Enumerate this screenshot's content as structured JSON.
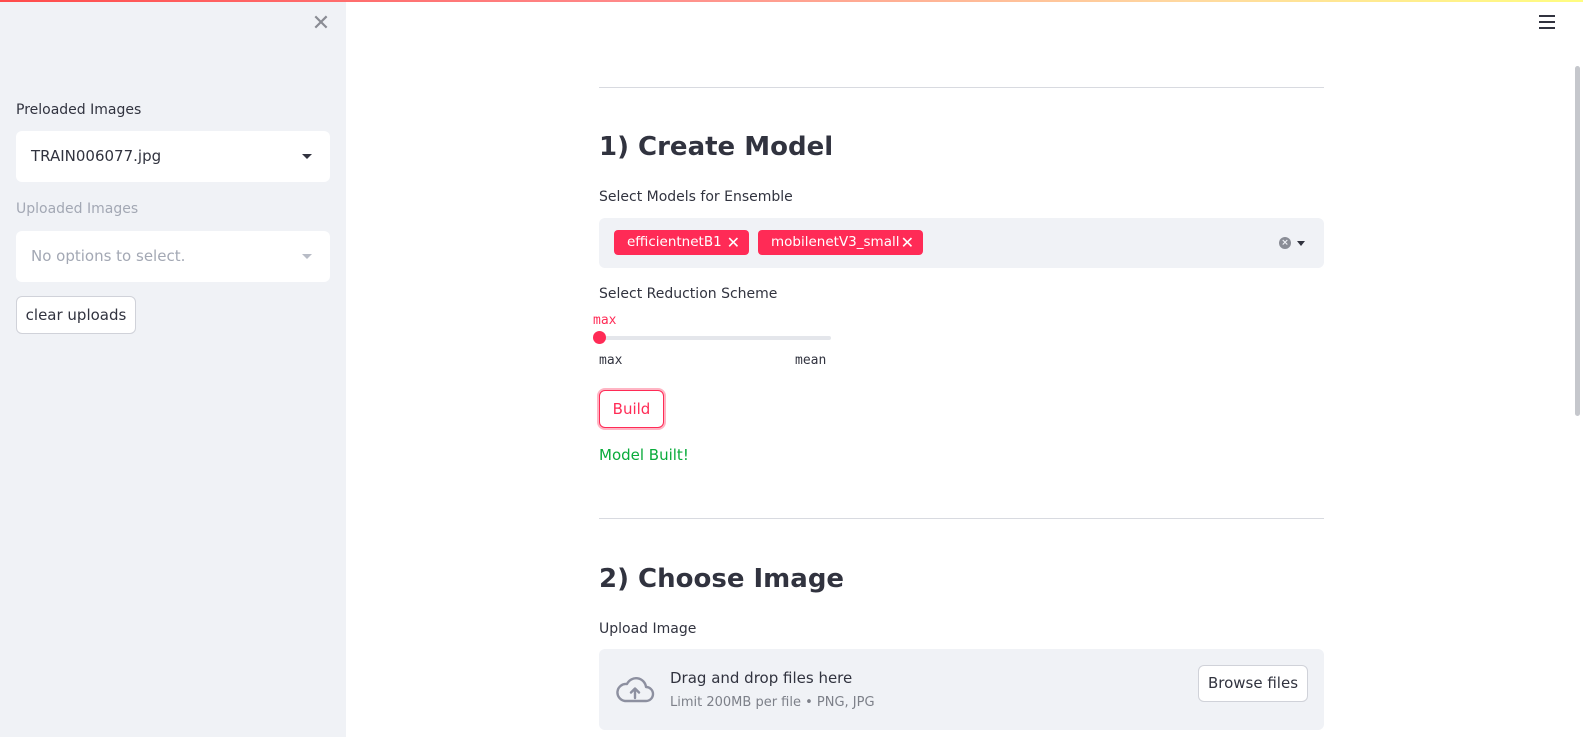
{
  "sidebar": {
    "close_glyph": "✕",
    "preloaded_label": "Preloaded Images",
    "preloaded_value": "TRAIN006077.jpg",
    "uploaded_label": "Uploaded Images",
    "uploaded_placeholder": "No options to select.",
    "clear_button": "clear uploads"
  },
  "section1": {
    "title": "1) Create Model",
    "models_label": "Select Models for Ensemble",
    "chips": [
      "efficientnetB1",
      "mobilenetV3_small"
    ],
    "chip_remove_glyph": "✕",
    "reduction_label": "Select Reduction Scheme",
    "slider_value": "max",
    "slider_min": "max",
    "slider_max": "mean",
    "build_button": "Build",
    "success_message": "Model Built!"
  },
  "section2": {
    "title": "2) Choose Image",
    "upload_label": "Upload Image",
    "drop_title": "Drag and drop files here",
    "drop_limits": "Limit 200MB per file • PNG, JPG",
    "browse_button": "Browse files"
  },
  "colors": {
    "accent": "#ff2b56",
    "success": "#09ab3b",
    "sidebar_bg": "#f0f2f6"
  },
  "icons": [
    "close-icon",
    "caret-down-icon",
    "menu-icon",
    "clear-icon",
    "cloud-upload-icon"
  ]
}
